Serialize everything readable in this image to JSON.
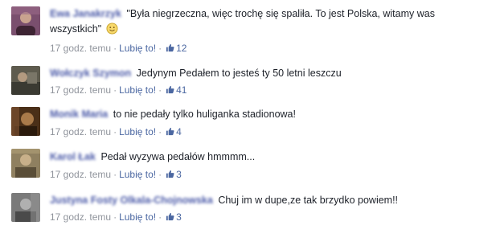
{
  "comments": [
    {
      "author": "Ewa Janakrzyk",
      "text": "\"Była niegrzeczna, więc trochę się spaliła. To jest Polska, witamy was wszystkich\"",
      "has_emoji": true,
      "time": "17 godz. temu",
      "like_label": "Lubię to!",
      "like_count": "12",
      "avatar_color": "#8a5a7a"
    },
    {
      "author": "Wołczyk Szymon",
      "text": "Jedynym Pedałem to jesteś ty 50 letni leszczu",
      "time": "17 godz. temu",
      "like_label": "Lubię to!",
      "like_count": "41",
      "avatar_color": "#6f6a5a"
    },
    {
      "author": "Monik Maria",
      "text": "to nie pedały tylko huliganka stadionowa!",
      "time": "17 godz. temu",
      "like_label": "Lubię to!",
      "like_count": "4",
      "avatar_color": "#6b4a2a"
    },
    {
      "author": "Karol Łak",
      "text": "Pedał wyzywa pedałów hmmmm...",
      "time": "17 godz. temu",
      "like_label": "Lubię to!",
      "like_count": "3",
      "avatar_color": "#8a7a5a"
    },
    {
      "author": "Justyna Fosty Olkala-Chojnowska",
      "text": "Chuj im w dupe,ze tak brzydko powiem!!",
      "time": "17 godz. temu",
      "like_label": "Lubię to!",
      "like_count": "3",
      "avatar_color": "#6a6a6a"
    }
  ],
  "separator": "·",
  "colors": {
    "author": "#4b5aa8",
    "link": "#4b67a1",
    "meta": "#90949c",
    "text": "#1d2129"
  }
}
